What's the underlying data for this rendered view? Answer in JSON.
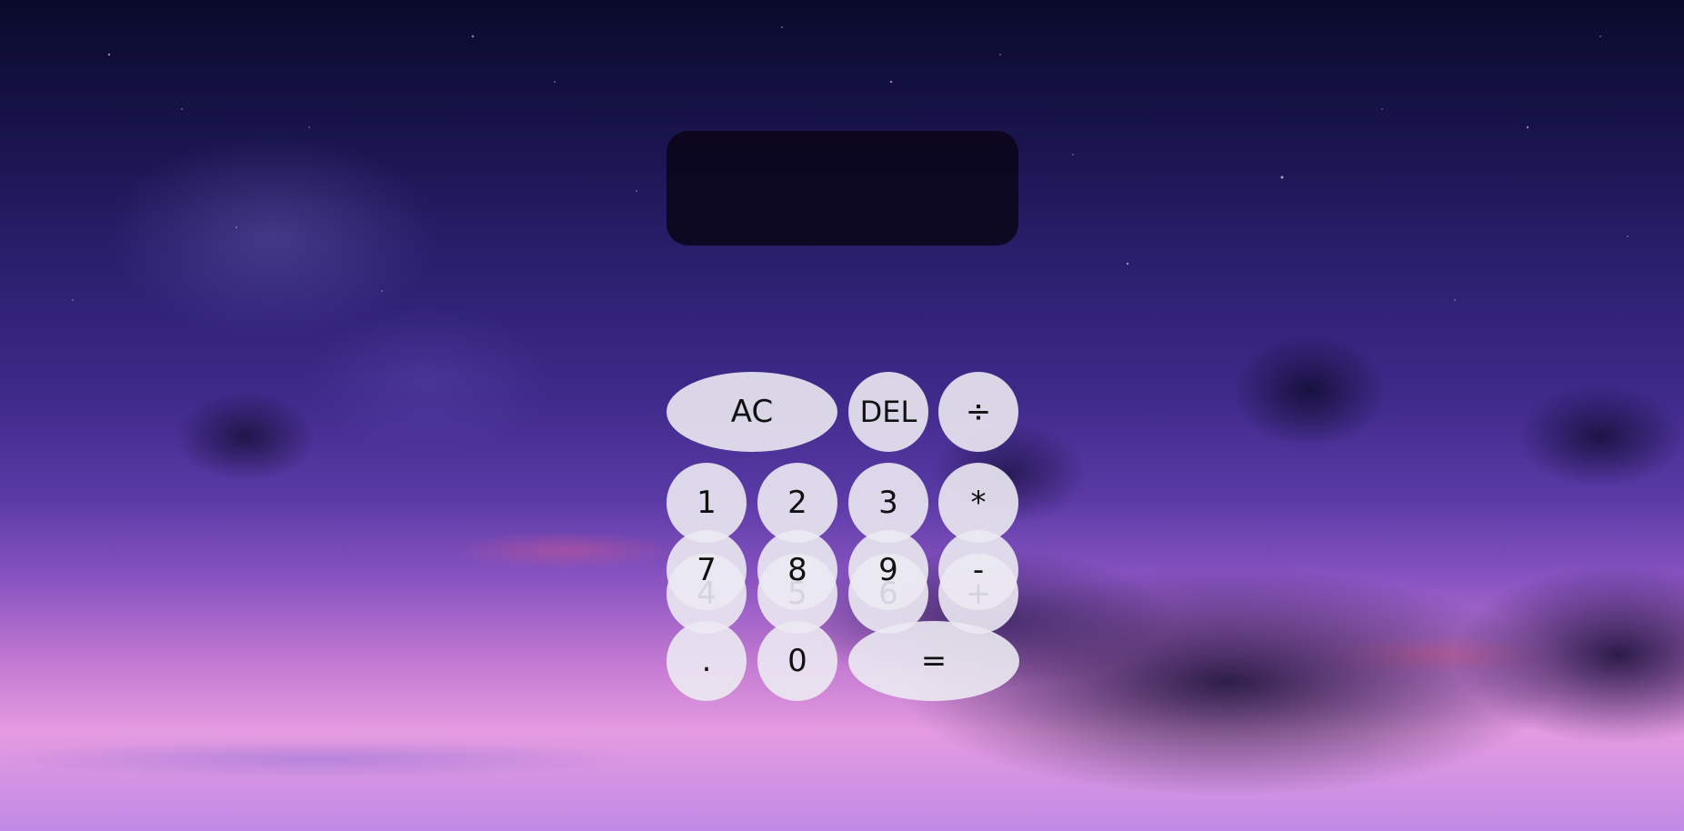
{
  "display": {
    "previous_operand": "",
    "current_operand": ""
  },
  "keys": {
    "ac": "AC",
    "del": "DEL",
    "divide": "÷",
    "one": "1",
    "two": "2",
    "three": "3",
    "multiply": "*",
    "four": "4",
    "five": "5",
    "six": "6",
    "plus": "+",
    "seven": "7",
    "eight": "8",
    "nine": "9",
    "minus": "-",
    "dot": ".",
    "zero": "0",
    "equals": "="
  }
}
